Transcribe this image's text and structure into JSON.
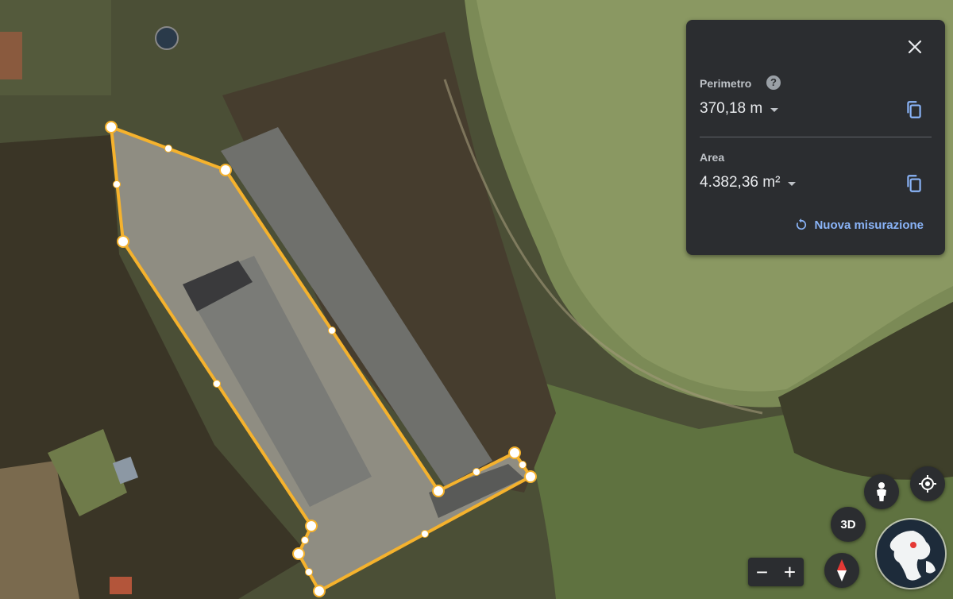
{
  "measure_panel": {
    "perimeter_label": "Perimetro",
    "perimeter_value": "370,18 m",
    "area_label": "Area",
    "area_value": "4.382,36 m²",
    "new_measure_label": "Nuova misurazione",
    "help_glyph": "?"
  },
  "map_controls": {
    "btn_3d_label": "3D",
    "zoom_out_label": "−",
    "zoom_in_label": "+"
  },
  "icons": {
    "close": "close-icon",
    "help": "help-icon",
    "copy": "copy-icon",
    "refresh": "refresh-icon",
    "pegman": "pegman-icon",
    "location": "my-location-icon",
    "compass": "compass-icon",
    "globe": "globe-icon"
  },
  "colors": {
    "measure_line": "#f5b22d",
    "panel_bg": "#2b2d30",
    "link_blue": "#8ab4f8",
    "compass_red": "#e53935"
  }
}
